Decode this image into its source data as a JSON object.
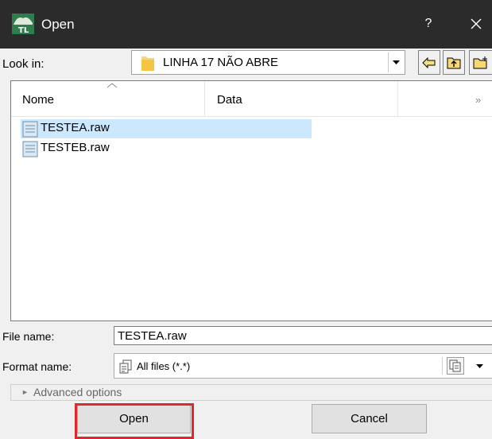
{
  "window": {
    "title": "Open",
    "help_label": "?"
  },
  "look_in": {
    "label": "Look in:",
    "folder": "LINHA 17 NÃO ABRE"
  },
  "toolbar": {
    "icons": [
      "back-icon",
      "up-folder-icon",
      "new-folder-icon"
    ]
  },
  "file_list": {
    "columns": [
      "Nome",
      "Data"
    ],
    "more_columns": "»",
    "files": [
      {
        "name": "TESTEA.raw",
        "selected": true
      },
      {
        "name": "TESTEB.raw",
        "selected": false
      }
    ]
  },
  "file_name": {
    "label": "File name:",
    "value": "TESTEA.raw"
  },
  "format_name": {
    "label": "Format name:",
    "selected": "All files (*.*)"
  },
  "advanced": {
    "label": "Advanced options"
  },
  "buttons": {
    "open": "Open",
    "cancel": "Cancel"
  },
  "colors": {
    "title_bar": "#2b2b2b",
    "selection": "#cce8ff",
    "highlight_box": "#e0262e",
    "folder": "#f8d775"
  }
}
